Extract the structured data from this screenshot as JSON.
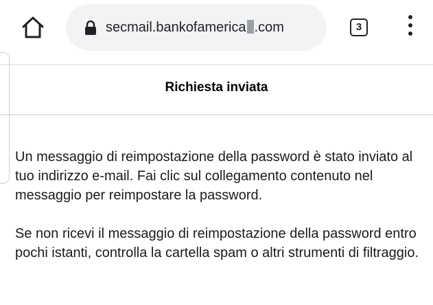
{
  "browser": {
    "url_before": "secmail.bankofamerica",
    "url_after": ".com",
    "tab_count": "3",
    "icons": {
      "home": "home-icon",
      "lock": "lock-icon",
      "tabs": "tabs-icon",
      "menu": "more-vert-icon"
    }
  },
  "page": {
    "title": "Richiesta inviata",
    "paragraphs": [
      "Un messaggio di reimpostazione della password è stato inviato al tuo indirizzo e-mail. Fai clic sul collegamento contenuto nel messaggio per reimpostare la password.",
      "Se non ricevi il messaggio di reimpostazione della password entro pochi istanti, controlla la cartella spam o altri strumenti di filtraggio."
    ]
  }
}
